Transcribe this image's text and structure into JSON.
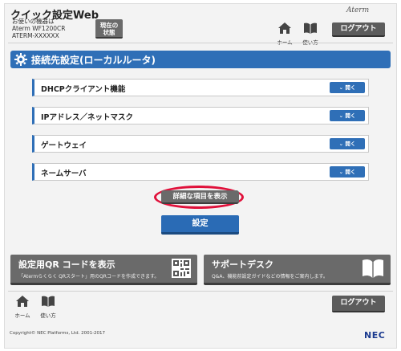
{
  "header": {
    "app_title": "クイック設定Web",
    "device_label": "お使いの機器は",
    "device_model": "Aterm WF1200CR",
    "device_id": "ATERM-XXXXXX",
    "status_button_line1": "現在の",
    "status_button_line2": "状態",
    "brand": "Aterm",
    "home_label": "ホーム",
    "help_label": "使い方",
    "logout_label": "ログアウト"
  },
  "section": {
    "title": "接続先設定(ローカルルータ)",
    "icon": "gear-icon"
  },
  "accordion": {
    "open_label": "開く",
    "items": [
      {
        "label": "DHCPクライアント機能"
      },
      {
        "label": "IPアドレス／ネットマスク"
      },
      {
        "label": "ゲートウェイ"
      },
      {
        "label": "ネームサーバ"
      }
    ]
  },
  "actions": {
    "detail_label": "詳細な項目を表示",
    "submit_label": "設定"
  },
  "panels": {
    "qr": {
      "title": "設定用QR コードを表示",
      "desc": "「Atermらくらく QRスタート」用のQRコードを作成できます。",
      "icon": "qr-code-icon"
    },
    "support": {
      "title": "サポートデスク",
      "desc": "Q&A、機能前設定ガイドなどの情報をご案内します。",
      "icon": "book-icon"
    }
  },
  "footer": {
    "home_label": "ホーム",
    "help_label": "使い方",
    "logout_label": "ログアウト",
    "copyright": "Copyright© NEC Platforms, Ltd. 2001-2017",
    "nec_logo": "NEC"
  },
  "colors": {
    "accent": "#2f6fb7",
    "highlight": "#e0103a",
    "dark_button": "#5c5c5c"
  }
}
